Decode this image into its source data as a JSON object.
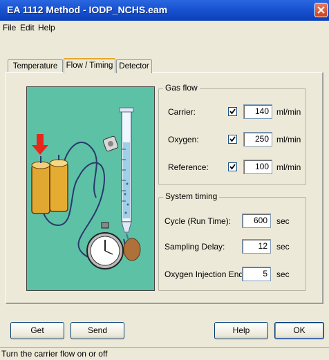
{
  "window": {
    "title": "EA 1112 Method - IODP_NCHS.eam",
    "close_icon": "close-icon"
  },
  "menu": {
    "file": "File",
    "edit": "Edit",
    "help": "Help"
  },
  "tabs": [
    {
      "label": "Temperature",
      "active": false
    },
    {
      "label": "Flow / Timing",
      "active": true
    },
    {
      "label": "Detector",
      "active": false
    }
  ],
  "gas_flow": {
    "title": "Gas flow",
    "rows": [
      {
        "label": "Carrier:",
        "checked": true,
        "value": "140",
        "unit": "ml/min"
      },
      {
        "label": "Oxygen:",
        "checked": true,
        "value": "250",
        "unit": "ml/min"
      },
      {
        "label": "Reference:",
        "checked": true,
        "value": "100",
        "unit": "ml/min"
      }
    ]
  },
  "system_timing": {
    "title": "System timing",
    "rows": [
      {
        "label": "Cycle (Run Time):",
        "value": "600",
        "unit": "sec"
      },
      {
        "label": "Sampling Delay:",
        "value": "12",
        "unit": "sec"
      },
      {
        "label": "Oxygen Injection End:",
        "value": "5",
        "unit": "sec"
      }
    ]
  },
  "buttons": {
    "get": "Get",
    "send": "Send",
    "help": "Help",
    "ok": "OK"
  },
  "status": "Turn the carrier flow on or off",
  "colors": {
    "illustration_bg": "#5dc1a6",
    "cylinder": "#e0a830",
    "arrow": "#e8261a",
    "titlebar": "#1c55d4"
  }
}
